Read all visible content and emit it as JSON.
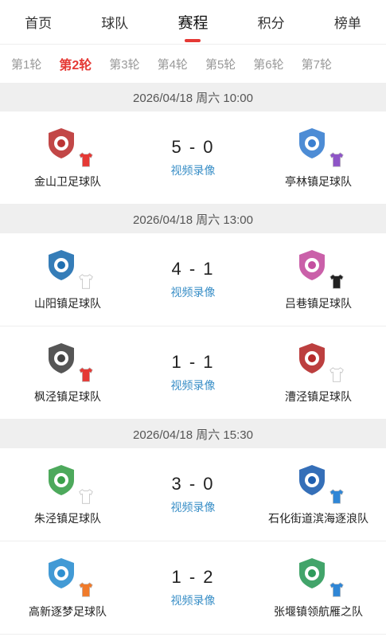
{
  "top_tabs": [
    {
      "label": "首页"
    },
    {
      "label": "球队"
    },
    {
      "label": "赛程"
    },
    {
      "label": "积分"
    },
    {
      "label": "榜单"
    }
  ],
  "active_top_tab": 2,
  "round_tabs": [
    {
      "label": "第1轮"
    },
    {
      "label": "第2轮"
    },
    {
      "label": "第3轮"
    },
    {
      "label": "第4轮"
    },
    {
      "label": "第5轮"
    },
    {
      "label": "第6轮"
    },
    {
      "label": "第7轮"
    }
  ],
  "active_round_tab": 1,
  "accent_color": "#e53935",
  "link_color": "#3a8fc7",
  "groups": [
    {
      "header": "2026/04/18 周六 10:00",
      "matches": [
        {
          "home": {
            "name": "金山卫足球队",
            "jersey_color": "#e53935",
            "logo_color": "#b33"
          },
          "score": "5 - 0",
          "video_label": "视频录像",
          "away": {
            "name": "亭林镇足球队",
            "jersey_color": "#8e55c7",
            "logo_color": "#3a7fd0"
          }
        }
      ]
    },
    {
      "header": "2026/04/18 周六 13:00",
      "matches": [
        {
          "home": {
            "name": "山阳镇足球队",
            "jersey_color": "#ffffff",
            "logo_color": "#1f6fb0"
          },
          "score": "4 - 1",
          "video_label": "视频录像",
          "away": {
            "name": "吕巷镇足球队",
            "jersey_color": "#222222",
            "logo_color": "#c44fa0"
          }
        },
        {
          "home": {
            "name": "枫泾镇足球队",
            "jersey_color": "#e53935",
            "logo_color": "#444"
          },
          "score": "1 - 1",
          "video_label": "视频录像",
          "away": {
            "name": "漕泾镇足球队",
            "jersey_color": "#ffffff",
            "logo_color": "#b52a2a"
          }
        }
      ]
    },
    {
      "header": "2026/04/18 周六 15:30",
      "matches": [
        {
          "home": {
            "name": "朱泾镇足球队",
            "jersey_color": "#ffffff",
            "logo_color": "#3aa04a"
          },
          "score": "3 - 0",
          "video_label": "视频录像",
          "away": {
            "name": "石化街道滨海逐浪队",
            "jersey_color": "#2f86d6",
            "logo_color": "#1f5fb0"
          }
        },
        {
          "home": {
            "name": "高新逐梦足球队",
            "jersey_color": "#f07a2a",
            "logo_color": "#2e8fd0"
          },
          "score": "1 - 2",
          "video_label": "视频录像",
          "away": {
            "name": "张堰镇领航雁之队",
            "jersey_color": "#2f86d6",
            "logo_color": "#2e9a5a"
          }
        }
      ]
    }
  ]
}
